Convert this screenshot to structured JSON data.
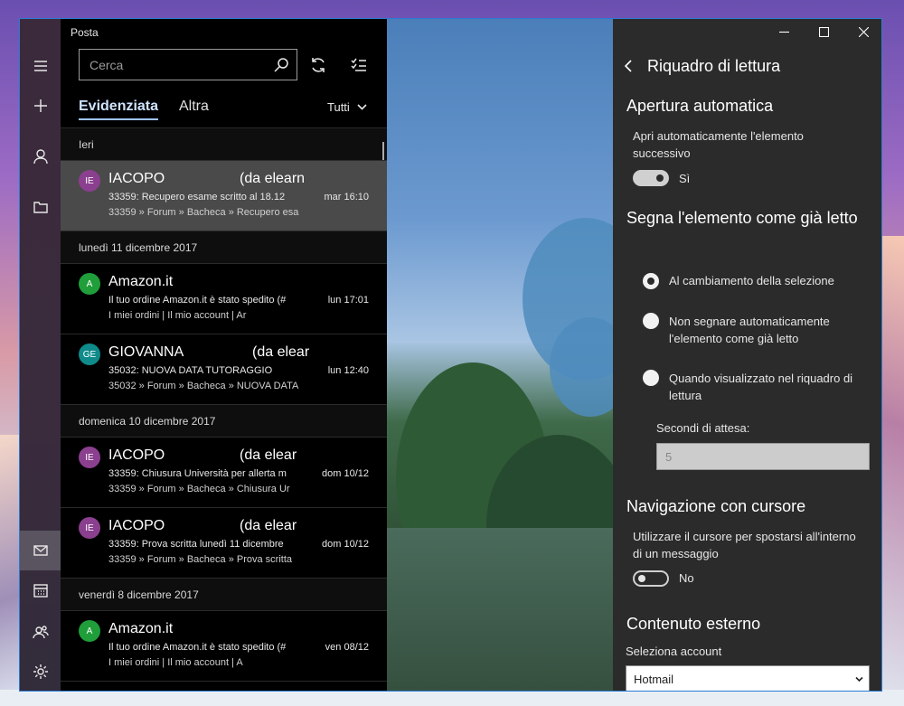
{
  "window": {
    "app_title": "Posta"
  },
  "rail": {
    "items": [
      {
        "name": "menu"
      },
      {
        "name": "new-mail"
      },
      {
        "name": "accounts"
      },
      {
        "name": "folders"
      },
      {
        "name": "mail"
      },
      {
        "name": "calendar"
      },
      {
        "name": "people"
      },
      {
        "name": "settings"
      }
    ]
  },
  "search": {
    "placeholder": "Cerca"
  },
  "tabs": {
    "focused": "Evidenziata",
    "other": "Altra",
    "filter": "Tutti"
  },
  "groups": [
    {
      "header": "Ieri",
      "items": [
        {
          "initials": "IE",
          "avatar_color": "#8b3f8f",
          "sender": "IACOPO",
          "sender_extra": "(da elearn",
          "subject": "33359: Recupero esame scritto al 18.12",
          "preview": "33359 » Forum » Bacheca » Recupero esa",
          "date": "mar 16:10",
          "selected": true
        }
      ]
    },
    {
      "header": "lunedì 11 dicembre 2017",
      "items": [
        {
          "initials": "A",
          "avatar_color": "#1f9e3a",
          "sender": "Amazon.it",
          "sender_extra": "",
          "subject": "Il tuo ordine Amazon.it è stato spedito (#",
          "preview": "I miei ordini     |    Il mio account    |    Ar",
          "date": "lun 17:01",
          "selected": false
        },
        {
          "initials": "GE",
          "avatar_color": "#0f8b8b",
          "sender": "GIOVANNA",
          "sender_extra": "(da elear",
          "subject": "35032: NUOVA DATA TUTORAGGIO",
          "preview": "35032 » Forum » Bacheca » NUOVA DATA",
          "date": "lun 12:40",
          "selected": false
        }
      ]
    },
    {
      "header": "domenica 10 dicembre 2017",
      "items": [
        {
          "initials": "IE",
          "avatar_color": "#8b3f8f",
          "sender": "IACOPO",
          "sender_extra": "(da elear",
          "subject": "33359: Chiusura Università per allerta m",
          "preview": "33359 » Forum » Bacheca » Chiusura Ur",
          "date": "dom 10/12",
          "selected": false
        },
        {
          "initials": "IE",
          "avatar_color": "#8b3f8f",
          "sender": "IACOPO",
          "sender_extra": "(da elear",
          "subject": "33359: Prova scritta lunedì 11 dicembre",
          "preview": "33359 » Forum » Bacheca » Prova scritta",
          "date": "dom 10/12",
          "selected": false
        }
      ]
    },
    {
      "header": "venerdì 8 dicembre 2017",
      "items": [
        {
          "initials": "A",
          "avatar_color": "#1f9e3a",
          "sender": "Amazon.it",
          "sender_extra": "",
          "subject": "Il tuo ordine Amazon.it è stato spedito (#",
          "preview": "I miei ordini     |    Il mio account    |    A",
          "date": "ven 08/12",
          "selected": false
        }
      ]
    }
  ],
  "settings": {
    "title": "Riquadro di lettura",
    "auto_open": {
      "heading": "Apertura automatica",
      "description": "Apri automaticamente l'elemento successivo",
      "toggle_on": true,
      "toggle_label": "Sì"
    },
    "mark_read": {
      "heading": "Segna l'elemento come già letto",
      "options": [
        {
          "label": "Al cambiamento della selezione",
          "checked": true
        },
        {
          "label": "Non segnare automaticamente l'elemento come già letto",
          "checked": false
        },
        {
          "label": "Quando visualizzato nel riquadro di lettura",
          "checked": false
        }
      ],
      "wait_label": "Secondi di attesa:",
      "wait_value": "5"
    },
    "caret": {
      "heading": "Navigazione con cursore",
      "description": "Utilizzare il cursore per spostarsi all'interno di un messaggio",
      "toggle_on": false,
      "toggle_label": "No"
    },
    "external": {
      "heading": "Contenuto esterno",
      "account_label": "Seleziona account",
      "account_value": "Hotmail"
    }
  }
}
